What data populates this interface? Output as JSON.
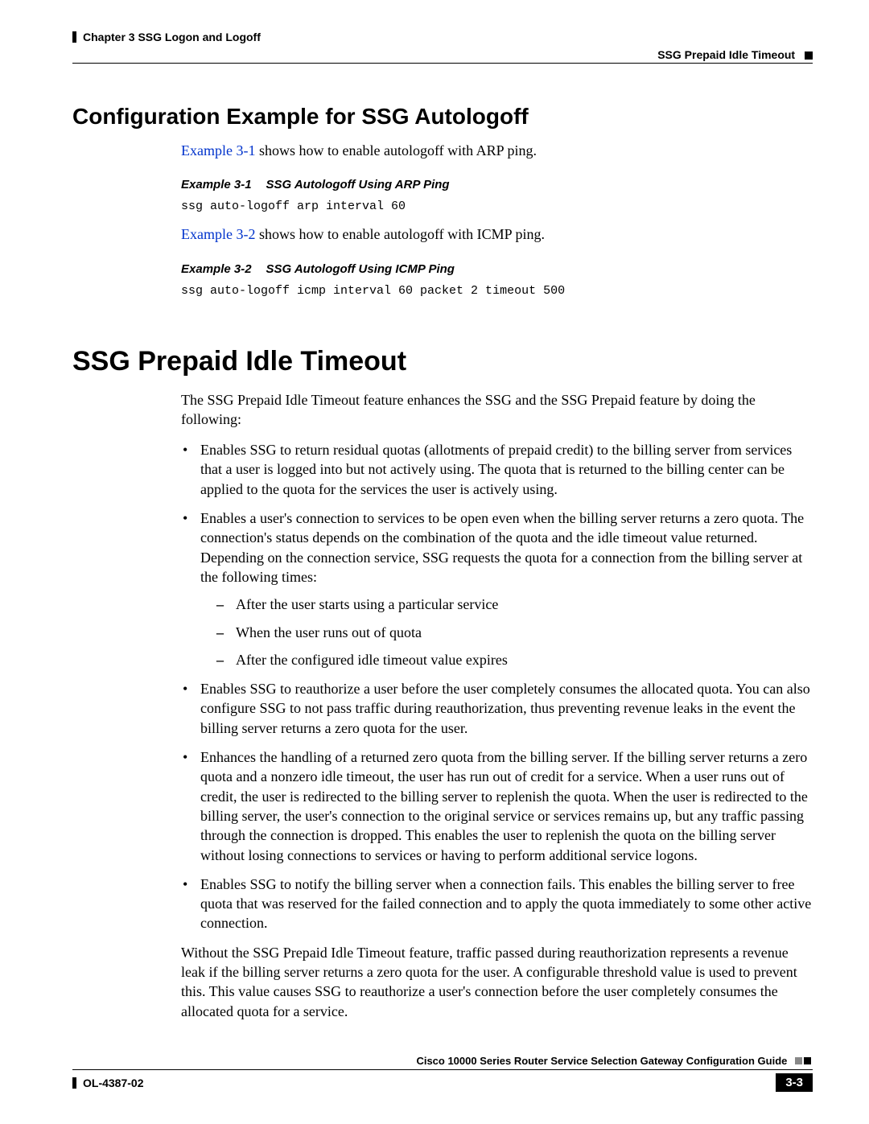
{
  "header": {
    "chapter": "Chapter 3      SSG Logon and Logoff",
    "section": "SSG Prepaid Idle Timeout"
  },
  "section1": {
    "title": "Configuration Example for SSG Autologoff",
    "intro_link": "Example 3-1",
    "intro_rest": " shows how to enable autologoff with ARP ping.",
    "ex1_num": "Example 3-1",
    "ex1_title": "SSG Autologoff Using ARP Ping",
    "ex1_code": "ssg auto-logoff arp interval 60",
    "intro2_link": "Example 3-2",
    "intro2_rest": " shows how to enable autologoff with ICMP ping.",
    "ex2_num": "Example 3-2",
    "ex2_title": "SSG Autologoff Using ICMP Ping",
    "ex2_code": "ssg auto-logoff icmp interval 60 packet 2 timeout 500"
  },
  "section2": {
    "title": "SSG Prepaid Idle Timeout",
    "intro": "The SSG Prepaid Idle Timeout feature enhances the SSG and the SSG Prepaid feature by doing the following:",
    "bullets": {
      "b1": "Enables SSG to return residual quotas (allotments of prepaid credit) to the billing server from services that a user is logged into but not actively using. The quota that is returned to the billing center can be applied to the quota for the services the user is actively using.",
      "b2": "Enables a user's connection to services to be open even when the billing server returns a zero quota. The connection's status depends on the combination of the quota and the idle timeout value returned. Depending on the connection service, SSG requests the quota for a connection from the billing server at the following times:",
      "b2_sub": {
        "d1": "After the user starts using a particular service",
        "d2": "When the user runs out of quota",
        "d3": "After the configured idle timeout value expires"
      },
      "b3": "Enables SSG to reauthorize a user before the user completely consumes the allocated quota. You can also configure SSG to not pass traffic during reauthorization, thus preventing revenue leaks in the event the billing server returns a zero quota for the user.",
      "b4": "Enhances the handling of a returned zero quota from the billing server. If the billing server returns a zero quota and a nonzero idle timeout, the user has run out of credit for a service. When a user runs out of credit, the user is redirected to the billing server to replenish the quota. When the user is redirected to the billing server, the user's connection to the original service or services remains up, but any traffic passing through the connection is dropped. This enables the user to replenish the quota on the billing server without losing connections to services or having to perform additional service logons.",
      "b5": "Enables SSG to notify the billing server when a connection fails. This enables the billing server to free quota that was reserved for the failed connection and to apply the quota immediately to some other active connection."
    },
    "closing": "Without the SSG Prepaid Idle Timeout feature, traffic passed during reauthorization represents a revenue leak if the billing server returns a zero quota for the user. A configurable threshold value is used to prevent this. This value causes SSG to reauthorize a user's connection before the user completely consumes the allocated quota for a service."
  },
  "footer": {
    "guide": "Cisco 10000 Series Router Service Selection Gateway Configuration Guide",
    "docid": "OL-4387-02",
    "page": "3-3"
  }
}
